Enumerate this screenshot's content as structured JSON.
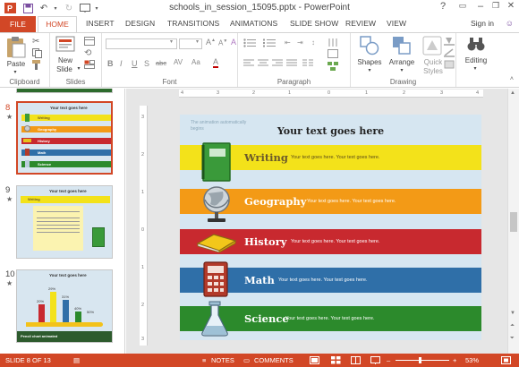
{
  "window": {
    "title": "schools_in_session_15095.pptx - PowerPoint",
    "help": "?",
    "minimize": "–",
    "restore": "❐",
    "close": "✕"
  },
  "tabs": {
    "file": "FILE",
    "items": [
      "HOME",
      "INSERT",
      "DESIGN",
      "TRANSITIONS",
      "ANIMATIONS",
      "SLIDE SHOW",
      "REVIEW",
      "VIEW"
    ],
    "sign_in": "Sign in"
  },
  "ribbon": {
    "clipboard": {
      "label": "Clipboard",
      "paste": "Paste"
    },
    "slides": {
      "label": "Slides",
      "new_slide_1": "New",
      "new_slide_2": "Slide"
    },
    "font": {
      "label": "Font",
      "bold": "B",
      "italic": "I",
      "underline": "U",
      "strike": "S",
      "shadow": "abc",
      "spacing": "AV",
      "case": "Aa",
      "color": "A"
    },
    "paragraph": {
      "label": "Paragraph"
    },
    "drawing": {
      "label": "Drawing",
      "shapes": "Shapes",
      "arrange": "Arrange",
      "quick_styles_1": "Quick",
      "quick_styles_2": "Styles"
    },
    "editing": {
      "label": "Editing"
    }
  },
  "thumbnails": [
    {
      "number": "8",
      "title": "Your text goes here",
      "rows": [
        "Writing",
        "Geography",
        "History",
        "Math",
        "Science"
      ]
    },
    {
      "number": "9",
      "title": "Your text goes here",
      "heading": "Writing"
    },
    {
      "number": "10",
      "title": "Your text goes here",
      "values": [
        "20%",
        "29%",
        "31%",
        "40%",
        "50%"
      ],
      "caption": "Pencil chart animated"
    }
  ],
  "slide": {
    "note": "The animation automatically begins",
    "title": "Your text goes here",
    "bands": [
      {
        "label": "Writing",
        "text": "Your text goes here. Your text goes here.",
        "color": "#f3e21a",
        "label_color": "#6b5a2a",
        "icon": "notebook-icon"
      },
      {
        "label": "Geography",
        "text": "Your text goes here. Your text goes here.",
        "color": "#f39a16",
        "label_color": "#ffffff",
        "icon": "globe-icon"
      },
      {
        "label": "History",
        "text": "Your text goes here. Your text goes here.",
        "color": "#c8292f",
        "label_color": "#ffffff",
        "icon": "book-icon"
      },
      {
        "label": "Math",
        "text": "Your text goes here. Your text goes here.",
        "color": "#2f6fa8",
        "label_color": "#ffffff",
        "icon": "calculator-icon"
      },
      {
        "label": "Science",
        "text": "Your text goes here. Your text goes here.",
        "color": "#2c8a2c",
        "label_color": "#ffffff",
        "icon": "flask-icon"
      }
    ]
  },
  "status": {
    "slide_count": "SLIDE 8 OF 13",
    "notes": "NOTES",
    "comments": "COMMENTS",
    "zoom": "53%",
    "zoom_minus": "–",
    "zoom_plus": "+"
  },
  "colors": {
    "accent": "#d24726",
    "slide_bg": "#d6e6f1"
  }
}
